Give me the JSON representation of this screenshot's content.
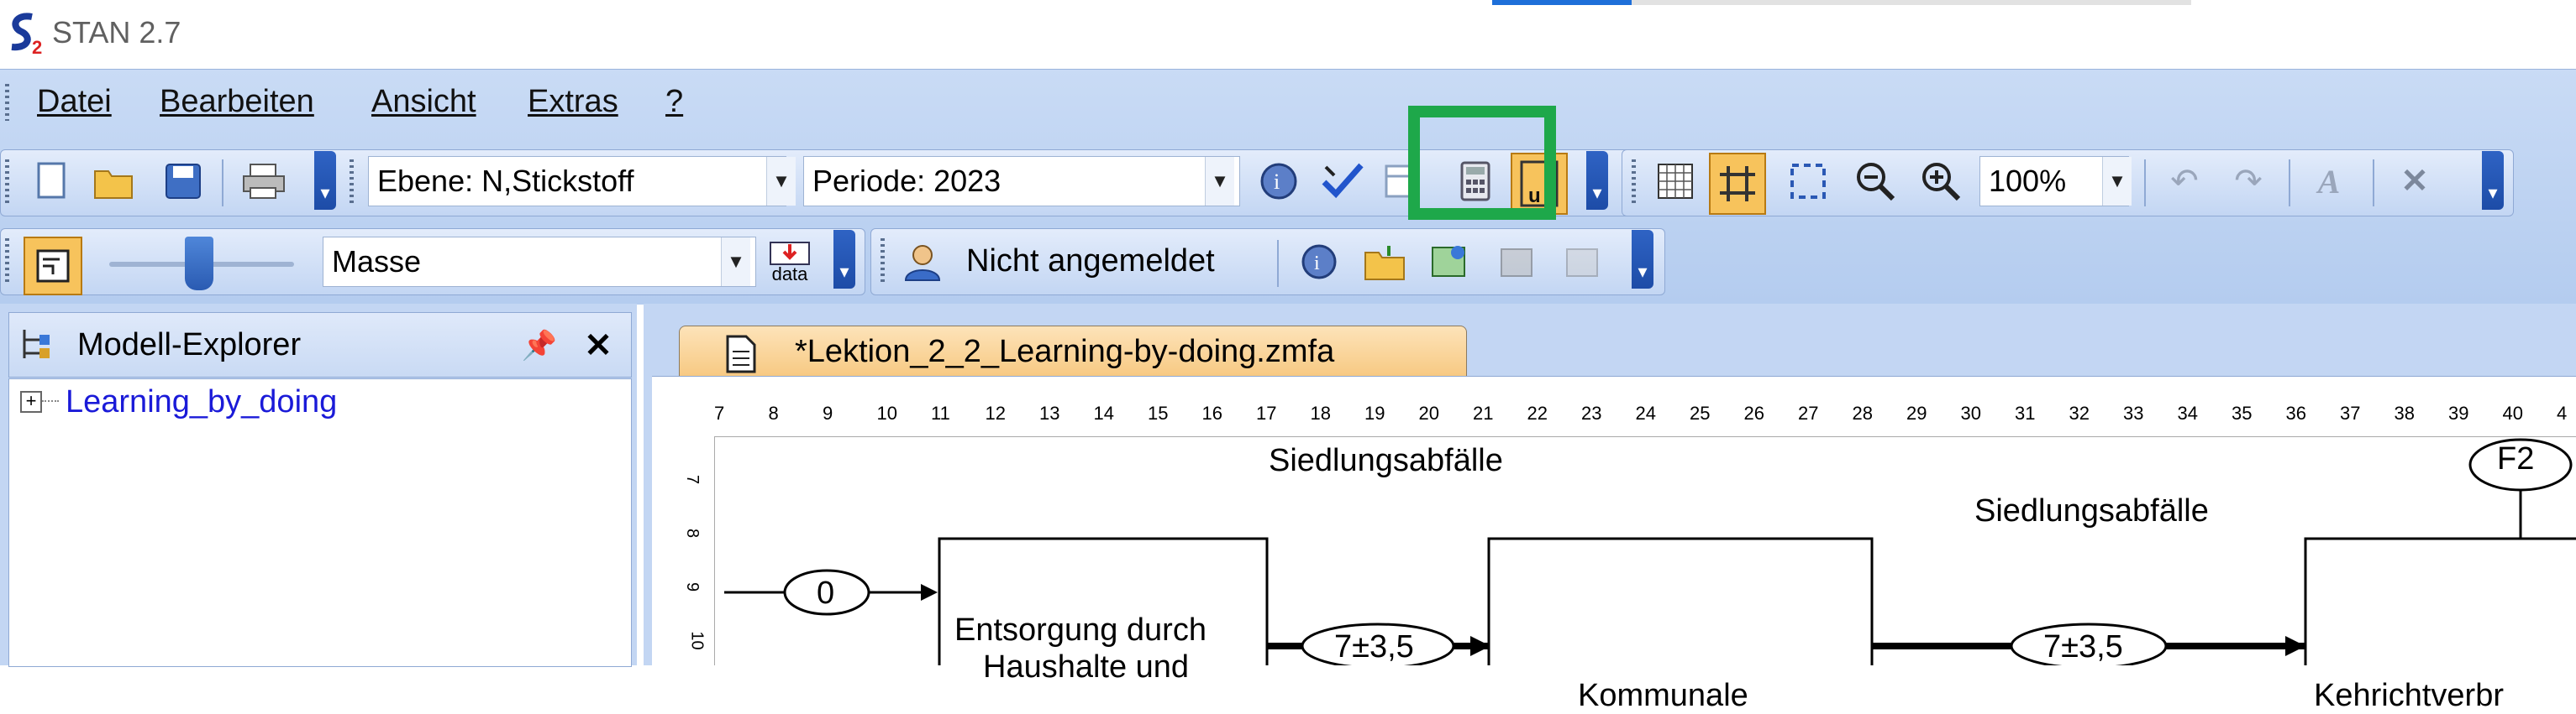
{
  "app": {
    "title": "STAN 2.7",
    "logo": "S2"
  },
  "menu": {
    "items": [
      {
        "label": "Datei"
      },
      {
        "label": "Bearbeiten"
      },
      {
        "label": "Ansicht"
      },
      {
        "label": "Extras"
      },
      {
        "label": "?"
      }
    ]
  },
  "toolbar1": {
    "ebene": "Ebene: N,Stickstoff",
    "periode": "Periode: 2023",
    "zoom": "100%"
  },
  "toolbar2": {
    "masse": "Masse",
    "data_label": "data",
    "user": "Nicht angemeldet"
  },
  "explorer": {
    "title": "Modell-Explorer",
    "tree_root": "Learning_by_doing"
  },
  "editor": {
    "tab_title": "*Lektion_2_2_Learning-by-doing.zmfa",
    "ruler_h": [
      "7",
      "8",
      "9",
      "10",
      "11",
      "12",
      "13",
      "14",
      "15",
      "16",
      "17",
      "18",
      "19",
      "20",
      "21",
      "22",
      "23",
      "24",
      "25",
      "26",
      "27",
      "28",
      "29",
      "30",
      "31",
      "32",
      "33",
      "34",
      "35",
      "36",
      "37",
      "38",
      "39",
      "40",
      "4"
    ],
    "ruler_v": [
      "7",
      "8",
      "9",
      "10"
    ]
  },
  "diagram": {
    "label_top": "Siedlungsabfälle",
    "label_right": "Siedlungsabfälle",
    "flow_in": "0",
    "process1_line1": "Entsorgung durch",
    "process1_line2": "Haushalte und",
    "flow1": "7±3,5",
    "process2": "Kommunale",
    "flow2": "7±3,5",
    "process3": "Kehrichtverbr",
    "f2": "F2"
  },
  "colors": {
    "highlight": "#1ea84a",
    "accent_blue": "#1e6fd9",
    "tree_link": "#1a1ad8"
  }
}
